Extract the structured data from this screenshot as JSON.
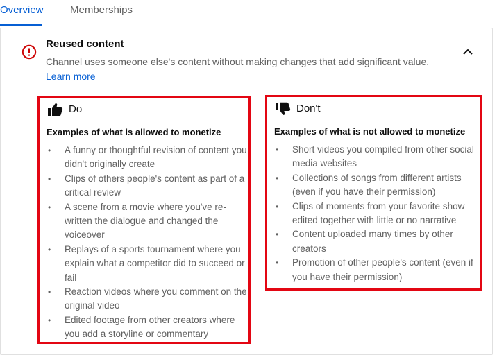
{
  "tabs": [
    {
      "label": "Overview"
    },
    {
      "label": "Memberships"
    }
  ],
  "section": {
    "title": "Reused content",
    "description": "Channel uses someone else's content without making changes that add significant value.",
    "learn_more": "Learn more"
  },
  "do_column": {
    "label": "Do",
    "heading": "Examples of what is allowed to monetize",
    "items": [
      "A funny or thoughtful revision of content you didn't originally create",
      "Clips of others people's content as part of a critical review",
      "A scene from a movie where you've re-written the dialogue and changed the voiceover",
      "Replays of a sports tournament where you explain what a competitor did to succeed or fail",
      "Reaction videos where you comment on the original video",
      "Edited footage from other creators where you add a storyline or commentary"
    ]
  },
  "dont_column": {
    "label": "Don't",
    "heading": "Examples of what is not allowed to monetize",
    "items": [
      "Short videos you compiled from other social media websites",
      "Collections of songs from different artists (even if you have their permission)",
      "Clips of moments from your favorite show edited together with little or no narrative",
      "Content uploaded many times by other creators",
      "Promotion of other people's content (even if you have their permission)"
    ]
  },
  "colors": {
    "accent_blue": "#065fd4",
    "warning_red": "#cc0000",
    "highlight_border": "#e30613"
  },
  "icons": [
    "error-circle-icon",
    "chevron-up-icon",
    "thumbs-up-icon",
    "thumbs-down-icon"
  ]
}
